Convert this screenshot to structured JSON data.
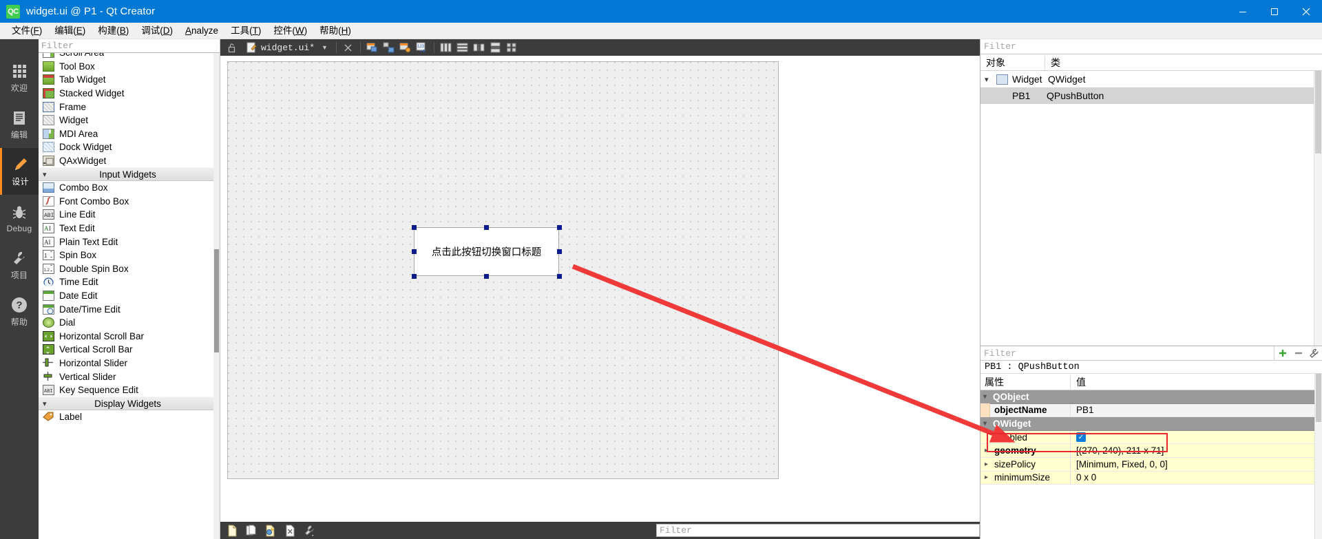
{
  "window": {
    "title": "widget.ui @ P1 - Qt Creator",
    "logo_text": "QC",
    "minimize_label": "–",
    "maximize_label": "☐",
    "close_label": "✕"
  },
  "menubar": {
    "items": [
      {
        "text": "文件(F)",
        "mnemonic": "F"
      },
      {
        "text": "编辑(E)",
        "mnemonic": "E"
      },
      {
        "text": "构建(B)",
        "mnemonic": "B"
      },
      {
        "text": "调试(D)",
        "mnemonic": "D"
      },
      {
        "text": "Analyze",
        "mnemonic": "A"
      },
      {
        "text": "工具(T)",
        "mnemonic": "T"
      },
      {
        "text": "控件(W)",
        "mnemonic": "W"
      },
      {
        "text": "帮助(H)",
        "mnemonic": "H"
      }
    ]
  },
  "modebar": {
    "items": [
      {
        "label": "欢迎",
        "icon": "grid-icon",
        "active": false
      },
      {
        "label": "编辑",
        "icon": "document-icon",
        "active": false
      },
      {
        "label": "设计",
        "icon": "pencil-icon",
        "active": true
      },
      {
        "label": "Debug",
        "icon": "bug-icon",
        "active": false
      },
      {
        "label": "项目",
        "icon": "wrench-icon",
        "active": false
      },
      {
        "label": "帮助",
        "icon": "question-icon",
        "active": false
      }
    ]
  },
  "widget_box": {
    "filter_placeholder": "Filter",
    "rows": [
      {
        "type": "item",
        "label": "Scroll Area",
        "icon": "scroll-area-icon"
      },
      {
        "type": "item",
        "label": "Tool Box",
        "icon": "tool-box-icon"
      },
      {
        "type": "item",
        "label": "Tab Widget",
        "icon": "tab-widget-icon"
      },
      {
        "type": "item",
        "label": "Stacked Widget",
        "icon": "stacked-widget-icon"
      },
      {
        "type": "item",
        "label": "Frame",
        "icon": "frame-icon"
      },
      {
        "type": "item",
        "label": "Widget",
        "icon": "widget-icon"
      },
      {
        "type": "item",
        "label": "MDI Area",
        "icon": "mdi-area-icon"
      },
      {
        "type": "item",
        "label": "Dock Widget",
        "icon": "dock-widget-icon"
      },
      {
        "type": "item",
        "label": "QAxWidget",
        "icon": "qaxwidget-icon"
      },
      {
        "type": "category",
        "label": "Input Widgets",
        "icon": "chevron-down-icon"
      },
      {
        "type": "item",
        "label": "Combo Box",
        "icon": "combo-box-icon"
      },
      {
        "type": "item",
        "label": "Font Combo Box",
        "icon": "font-combo-box-icon"
      },
      {
        "type": "item",
        "label": "Line Edit",
        "icon": "line-edit-icon"
      },
      {
        "type": "item",
        "label": "Text Edit",
        "icon": "text-edit-icon"
      },
      {
        "type": "item",
        "label": "Plain Text Edit",
        "icon": "plain-text-edit-icon"
      },
      {
        "type": "item",
        "label": "Spin Box",
        "icon": "spin-box-icon"
      },
      {
        "type": "item",
        "label": "Double Spin Box",
        "icon": "double-spin-box-icon"
      },
      {
        "type": "item",
        "label": "Time Edit",
        "icon": "time-edit-icon"
      },
      {
        "type": "item",
        "label": "Date Edit",
        "icon": "date-edit-icon"
      },
      {
        "type": "item",
        "label": "Date/Time Edit",
        "icon": "date-time-edit-icon"
      },
      {
        "type": "item",
        "label": "Dial",
        "icon": "dial-icon"
      },
      {
        "type": "item",
        "label": "Horizontal Scroll Bar",
        "icon": "horizontal-scroll-bar-icon"
      },
      {
        "type": "item",
        "label": "Vertical Scroll Bar",
        "icon": "vertical-scroll-bar-icon"
      },
      {
        "type": "item",
        "label": "Horizontal Slider",
        "icon": "horizontal-slider-icon"
      },
      {
        "type": "item",
        "label": "Vertical Slider",
        "icon": "vertical-slider-icon"
      },
      {
        "type": "item",
        "label": "Key Sequence Edit",
        "icon": "key-sequence-edit-icon"
      },
      {
        "type": "category",
        "label": "Display Widgets",
        "icon": "chevron-down-icon"
      },
      {
        "type": "item",
        "label": "Label",
        "icon": "label-icon"
      }
    ]
  },
  "editor_toolbar": {
    "file_name": "widget.ui*",
    "lock_icon": "unlock-icon",
    "file_icon": "ui-file-icon",
    "dropdown_icon": "chevron-down-icon",
    "close_icon": "close-icon",
    "buttons": [
      {
        "icon": "edit-widgets-icon",
        "name": "edit-widgets"
      },
      {
        "icon": "edit-signals-slots-icon",
        "name": "edit-signals-slots"
      },
      {
        "icon": "edit-buddies-icon",
        "name": "edit-buddies"
      },
      {
        "icon": "edit-tab-order-icon",
        "name": "edit-tab-order"
      },
      {
        "icon": "layout-horizontally-icon",
        "name": "layout-horizontally"
      },
      {
        "icon": "layout-vertically-icon",
        "name": "layout-vertically"
      },
      {
        "icon": "layout-splitter-h-icon",
        "name": "layout-splitter-horizontal"
      },
      {
        "icon": "layout-splitter-v-icon",
        "name": "layout-splitter-vertical"
      },
      {
        "icon": "layout-grid-icon",
        "name": "layout-in-grid"
      },
      {
        "icon": "layout-form-icon",
        "name": "layout-in-form"
      },
      {
        "icon": "break-layout-icon",
        "name": "break-layout"
      },
      {
        "icon": "adjust-size-icon",
        "name": "adjust-size"
      }
    ]
  },
  "form": {
    "button_text": "点击此按钮切换窗口标题",
    "selection_handles": 8
  },
  "bottom_toolbar": {
    "icons": [
      {
        "icon": "new-file-icon",
        "name": "new-file"
      },
      {
        "icon": "copy-icon",
        "name": "copy"
      },
      {
        "icon": "resource-icon",
        "name": "resource-browser"
      },
      {
        "icon": "delete-icon",
        "name": "delete"
      },
      {
        "icon": "settings-wrench-icon",
        "name": "settings"
      }
    ],
    "filter_placeholder": "Filter"
  },
  "object_inspector": {
    "filter_placeholder": "Filter",
    "columns": [
      "对象",
      "类"
    ],
    "rows": [
      {
        "name": "Widget",
        "class": "QWidget",
        "indent": 0,
        "expanded": true,
        "selected": false,
        "icon": "widget-tree-icon"
      },
      {
        "name": "PB1",
        "class": "QPushButton",
        "indent": 1,
        "expanded": false,
        "selected": true,
        "icon": ""
      }
    ]
  },
  "property_editor": {
    "filter_placeholder": "Filter",
    "add_button_icon": "plus-icon",
    "remove_button_icon": "minus-icon",
    "config_button_icon": "wrench-icon",
    "object_header": "PB1 : QPushButton",
    "columns": [
      "属性",
      "值"
    ],
    "rows": [
      {
        "kind": "group",
        "name": "QObject",
        "value": "",
        "expanded": true
      },
      {
        "kind": "prop",
        "name": "objectName",
        "value": "PB1",
        "bold": true,
        "highlight": "light",
        "swatch": "#ffdfbf",
        "expandable": false
      },
      {
        "kind": "group",
        "name": "QWidget",
        "value": "",
        "expanded": true
      },
      {
        "kind": "prop",
        "name": "enabled",
        "value": "",
        "checkbox": true,
        "checked": true,
        "highlight": "yellow",
        "expandable": false
      },
      {
        "kind": "prop",
        "name": "geometry",
        "value": "[(270, 240), 211 x 71]",
        "bold": true,
        "highlight": "yellow",
        "expandable": true
      },
      {
        "kind": "prop",
        "name": "sizePolicy",
        "value": "[Minimum, Fixed, 0, 0]",
        "highlight": "yellow",
        "expandable": true
      },
      {
        "kind": "prop",
        "name": "minimumSize",
        "value": "0 x 0",
        "highlight": "yellow",
        "expandable": true
      }
    ]
  },
  "annotation": {
    "highlight_color": "#e8282d",
    "arrow_color": "#f03a3a",
    "description": "red arrow pointing from form pushbutton to objectName property row"
  }
}
